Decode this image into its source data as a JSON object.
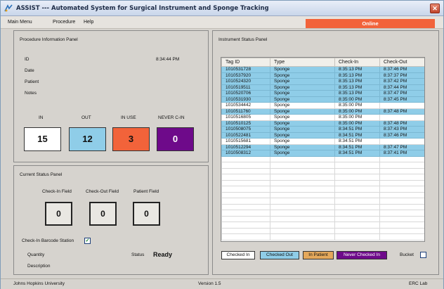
{
  "title": "ASSIST --- Automated System for Surgical Instrument and Sponge Tracking",
  "menu": [
    "Main Menu",
    "Procedure",
    "Help"
  ],
  "connection_status": "Online",
  "procedure_panel": {
    "title": "Procedure Information Panel",
    "id_label": "ID",
    "time": "8:34:44 PM",
    "date_label": "Date",
    "patient_label": "Patient",
    "notes_label": "Notes",
    "counts": [
      {
        "label": "IN",
        "value": "15",
        "color": "#ffffff",
        "text_color": "#111111"
      },
      {
        "label": "OUT",
        "value": "12",
        "color": "#8fcde8",
        "text_color": "#111111"
      },
      {
        "label": "IN USE",
        "value": "3",
        "color": "#f2633a",
        "text_color": "#111111"
      },
      {
        "label": "NEVER C-IN",
        "value": "0",
        "color": "#6e0a8a",
        "text_color": "#ffffff"
      }
    ]
  },
  "current_panel": {
    "title": "Current Status Panel",
    "fields": [
      {
        "label": "Check-In Field",
        "value": "0"
      },
      {
        "label": "Check-Out Field",
        "value": "0"
      },
      {
        "label": "Patient Field",
        "value": "0"
      }
    ],
    "barcode_label": "Check-In Barcode Station",
    "barcode_checked": "✓",
    "quantity_label": "Quantity",
    "description_label": "Description",
    "status_label": "Status",
    "status_value": "Ready"
  },
  "instrument_panel": {
    "title": "Instrument Status Panel",
    "columns": [
      "Tag ID",
      "Type",
      "Check-In",
      "Check-Out"
    ],
    "rows": [
      {
        "tag": "1010531728",
        "type": "Sponge",
        "in": "8:35:13 PM",
        "out": "8:37:46 PM",
        "state": "out"
      },
      {
        "tag": "1010537920",
        "type": "Sponge",
        "in": "8:35:13 PM",
        "out": "8:37:37 PM",
        "state": "out"
      },
      {
        "tag": "1010524320",
        "type": "Sponge",
        "in": "8:35:13 PM",
        "out": "8:37:42 PM",
        "state": "out"
      },
      {
        "tag": "1010519511",
        "type": "Sponge",
        "in": "8:35:13 PM",
        "out": "8:37:44 PM",
        "state": "out"
      },
      {
        "tag": "1010520706",
        "type": "Sponge",
        "in": "8:35:13 PM",
        "out": "8:37:47 PM",
        "state": "out"
      },
      {
        "tag": "1010531930",
        "type": "Sponge",
        "in": "8:35:00 PM",
        "out": "8:37:45 PM",
        "state": "out"
      },
      {
        "tag": "1010534442",
        "type": "Sponge",
        "in": "8:35:00 PM",
        "out": "",
        "state": "in"
      },
      {
        "tag": "1010511760",
        "type": "Sponge",
        "in": "8:35:00 PM",
        "out": "8:37:48 PM",
        "state": "out"
      },
      {
        "tag": "1010516805",
        "type": "Sponge",
        "in": "8:35:00 PM",
        "out": "",
        "state": "in"
      },
      {
        "tag": "1010510125",
        "type": "Sponge",
        "in": "8:35:00 PM",
        "out": "8:37:48 PM",
        "state": "out"
      },
      {
        "tag": "1010508075",
        "type": "Sponge",
        "in": "8:34:51 PM",
        "out": "8:37:43 PM",
        "state": "out"
      },
      {
        "tag": "1010522481",
        "type": "Sponge",
        "in": "8:34:51 PM",
        "out": "8:37:46 PM",
        "state": "out"
      },
      {
        "tag": "1010515681",
        "type": "Sponge",
        "in": "8:34:51 PM",
        "out": "",
        "state": "in"
      },
      {
        "tag": "1010512294",
        "type": "Sponge",
        "in": "8:34:51 PM",
        "out": "8:37:47 PM",
        "state": "out"
      },
      {
        "tag": "1010508312",
        "type": "Sponge",
        "in": "8:34:51 PM",
        "out": "8:37:41 PM",
        "state": "out"
      }
    ],
    "legend": [
      {
        "label": "Checked In",
        "color": "#ffffff",
        "text_color": "#111111"
      },
      {
        "label": "Checked Out",
        "color": "#8fcde8",
        "text_color": "#111111"
      },
      {
        "label": "In Patient",
        "color": "#e4a85b",
        "text_color": "#111111"
      },
      {
        "label": "Never Checked In",
        "color": "#6e0a8a",
        "text_color": "#ffffff"
      }
    ],
    "bucket_label": "Bucket"
  },
  "statusbar": {
    "left": "Johns Hopkins University",
    "center": "Version 1.5",
    "right": "ERC Lab"
  }
}
